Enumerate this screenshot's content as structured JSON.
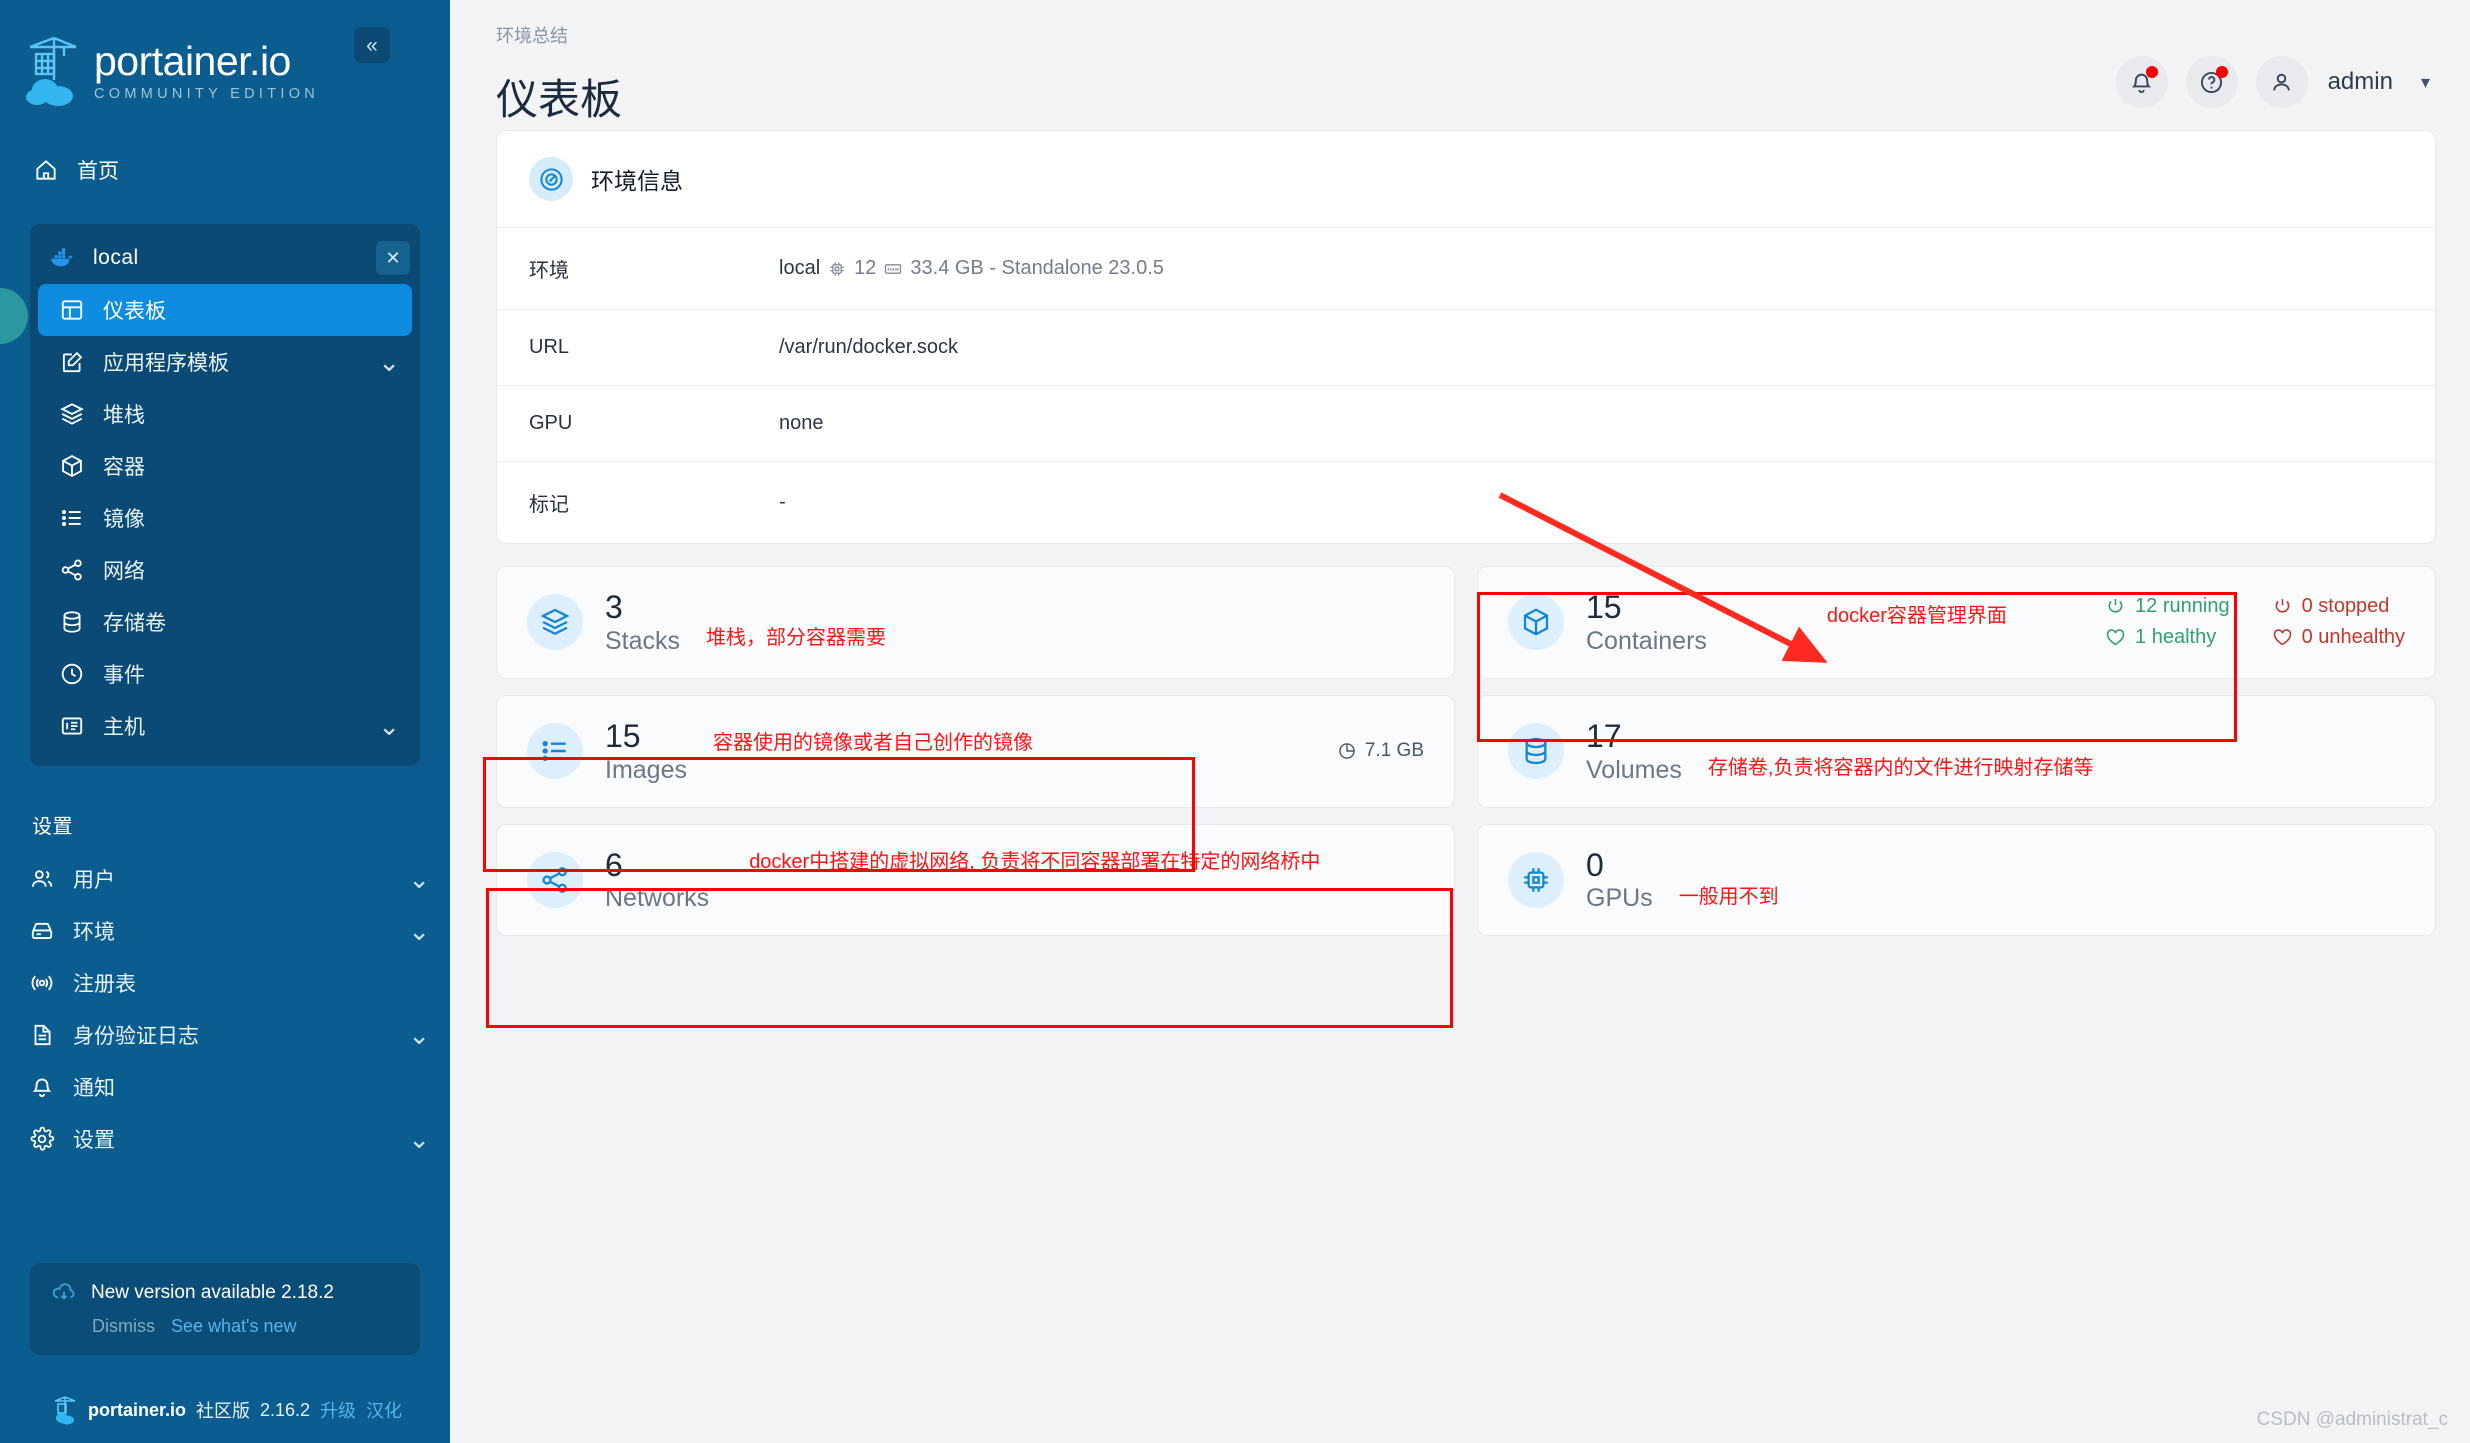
{
  "brand": {
    "name": "portainer.io",
    "subtitle": "COMMUNITY EDITION",
    "collapse_icon": "chevrons-left-icon"
  },
  "sidebar": {
    "home_label": "首页",
    "environment": {
      "name": "local",
      "close_icon": "close-icon"
    },
    "nav_items": [
      {
        "label": "仪表板",
        "icon": "dashboard-icon",
        "active": true,
        "chevron": false
      },
      {
        "label": "应用程序模板",
        "icon": "template-icon",
        "active": false,
        "chevron": true
      },
      {
        "label": "堆栈",
        "icon": "layers-icon",
        "active": false,
        "chevron": false
      },
      {
        "label": "容器",
        "icon": "box-icon",
        "active": false,
        "chevron": false
      },
      {
        "label": "镜像",
        "icon": "list-icon",
        "active": false,
        "chevron": false
      },
      {
        "label": "网络",
        "icon": "share-icon",
        "active": false,
        "chevron": false
      },
      {
        "label": "存储卷",
        "icon": "database-icon",
        "active": false,
        "chevron": false
      },
      {
        "label": "事件",
        "icon": "clock-icon",
        "active": false,
        "chevron": false
      },
      {
        "label": "主机",
        "icon": "host-icon",
        "active": false,
        "chevron": true
      }
    ],
    "settings_title": "设置",
    "settings_items": [
      {
        "label": "用户",
        "icon": "users-icon",
        "chevron": true
      },
      {
        "label": "环境",
        "icon": "server-icon",
        "chevron": true
      },
      {
        "label": "注册表",
        "icon": "radio-icon",
        "chevron": false
      },
      {
        "label": "身份验证日志",
        "icon": "file-text-icon",
        "chevron": true
      },
      {
        "label": "通知",
        "icon": "bell-icon",
        "chevron": false
      },
      {
        "label": "设置",
        "icon": "gear-icon",
        "chevron": true
      }
    ],
    "update": {
      "icon": "cloud-download-icon",
      "message": "New version available 2.18.2",
      "dismiss_label": "Dismiss",
      "whats_new_label": "See what's new"
    },
    "footer": {
      "logo_icon": "portainer-logo-icon",
      "product": "portainer.io",
      "edition": "社区版",
      "version": "2.16.2",
      "upgrade_label": "升级",
      "locale_label": "汉化"
    }
  },
  "header": {
    "breadcrumb": "环境总结",
    "title": "仪表板",
    "notification_icon": "bell-icon",
    "help_icon": "help-circle-icon",
    "avatar_icon": "user-icon",
    "user": "admin",
    "chevron_icon": "chevron-down-icon"
  },
  "env_panel": {
    "icon": "gauge-icon",
    "title": "环境信息",
    "rows": [
      {
        "label": "环境",
        "value": "local",
        "cpu_icon": "cpu-icon",
        "cpu": "12",
        "mem_icon": "memory-icon",
        "mem": "33.4 GB - Standalone 23.0.5"
      },
      {
        "label": "URL",
        "value": "/var/run/docker.sock"
      },
      {
        "label": "GPU",
        "value": "none"
      },
      {
        "label": "标记",
        "value": "-"
      }
    ]
  },
  "stats": {
    "stacks": {
      "icon": "layers-icon",
      "count": "3",
      "label": "Stacks",
      "note": "堆栈，部分容器需要"
    },
    "containers": {
      "icon": "box-icon",
      "count": "15",
      "label": "Containers",
      "note": "docker容器管理界面",
      "statuses": [
        {
          "icon": "power-icon",
          "text": "12 running",
          "tone": "ok"
        },
        {
          "icon": "power-icon",
          "text": "0 stopped",
          "tone": "bad"
        },
        {
          "icon": "heart-icon",
          "text": "1 healthy",
          "tone": "ok"
        },
        {
          "icon": "heart-icon",
          "text": "0 unhealthy",
          "tone": "bad"
        }
      ]
    },
    "images": {
      "icon": "list-icon",
      "count": "15",
      "label": "Images",
      "note": "容器使用的镜像或者自己创作的镜像",
      "size_icon": "pie-icon",
      "size": "7.1 GB"
    },
    "volumes": {
      "icon": "database-icon",
      "count": "17",
      "label": "Volumes",
      "note": "存储卷,负责将容器内的文件进行映射存储等"
    },
    "networks": {
      "icon": "share-icon",
      "count": "6",
      "label": "Networks",
      "note": "docker中搭建的虚拟网络, 负责将不同容器部署在特定的网络桥中"
    },
    "gpus": {
      "icon": "chip-icon",
      "count": "0",
      "label": "GPUs",
      "note": "一般用不到"
    }
  },
  "annotations": {
    "arrow_color": "#ff2a20",
    "box_color": "#ff0000"
  },
  "watermark": "CSDN @administrat_c"
}
